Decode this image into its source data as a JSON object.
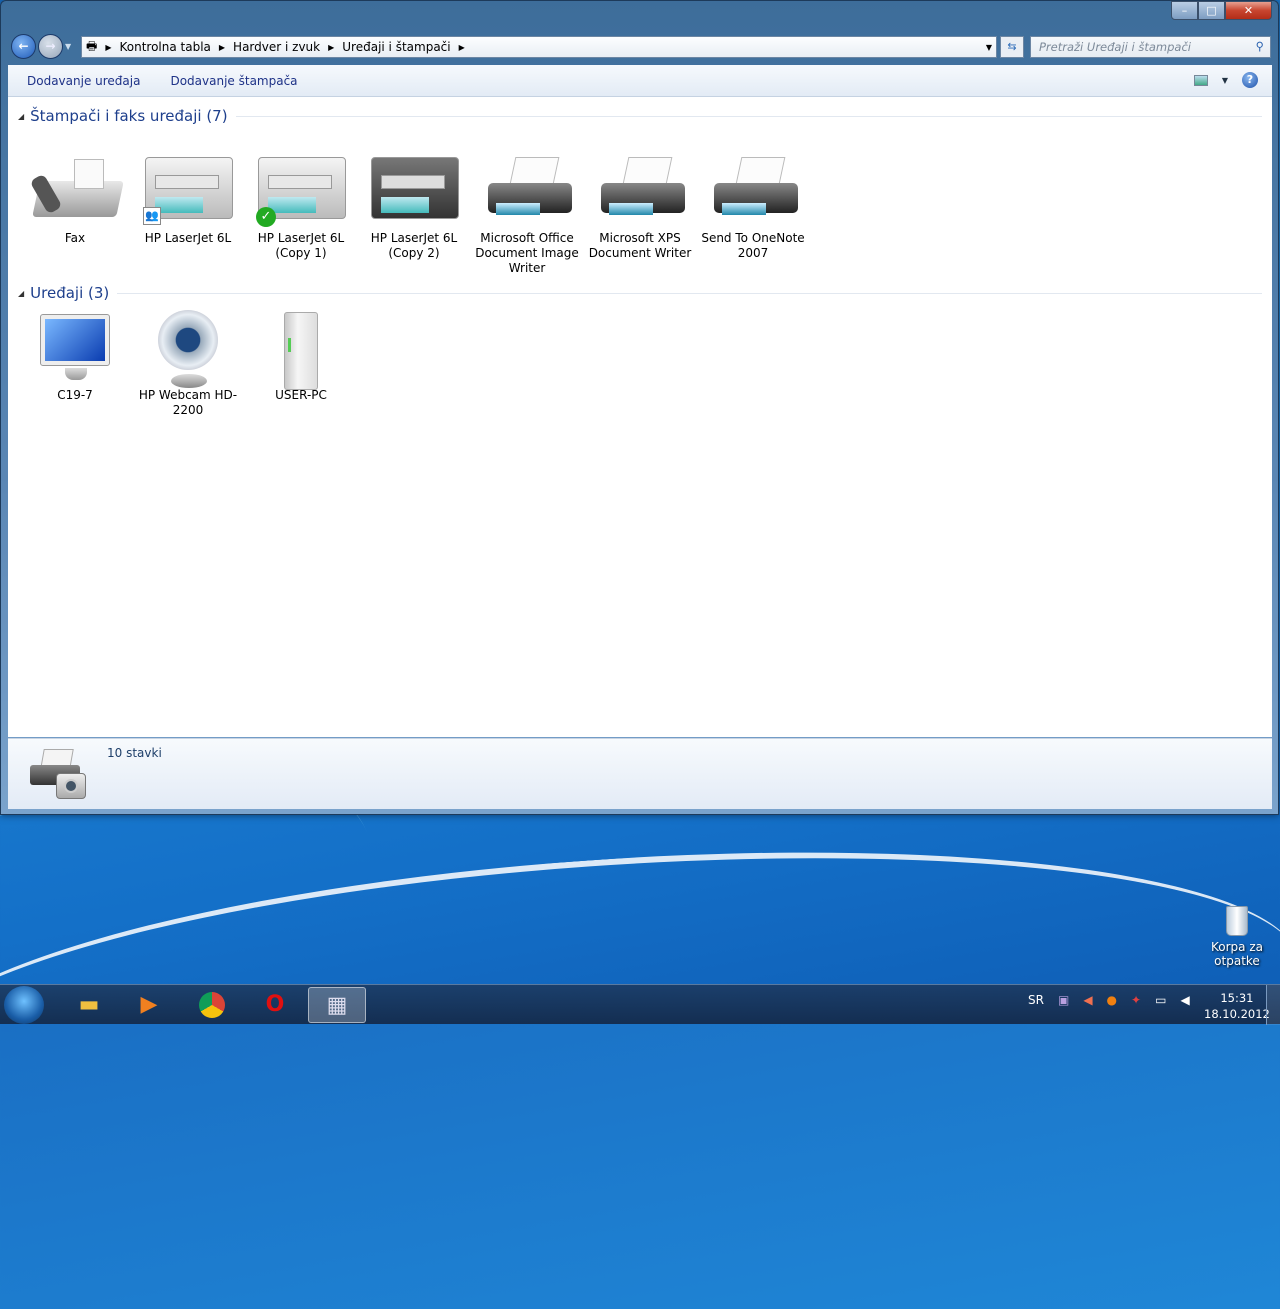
{
  "window": {
    "caption": {
      "minimize": "–",
      "maximize": "□",
      "close": "✕"
    }
  },
  "breadcrumb": [
    "Kontrolna tabla",
    "Hardver i zvuk",
    "Uređaji i štampači"
  ],
  "search": {
    "placeholder": "Pretraži Uređaji i štampači"
  },
  "toolbar": {
    "add_device": "Dodavanje uređaja",
    "add_printer": "Dodavanje štampača",
    "help": "?"
  },
  "groups": [
    {
      "title": "Štampači i faks uređaji (7)",
      "items": [
        {
          "label": "Fax",
          "icon": "fax"
        },
        {
          "label": "HP LaserJet 6L",
          "icon": "laser-shared"
        },
        {
          "label": "HP LaserJet 6L (Copy 1)",
          "icon": "laser-default"
        },
        {
          "label": "HP LaserJet 6L (Copy 2)",
          "icon": "laser-dark"
        },
        {
          "label": "Microsoft Office Document Image Writer",
          "icon": "printer"
        },
        {
          "label": "Microsoft XPS Document Writer",
          "icon": "printer"
        },
        {
          "label": "Send To OneNote 2007",
          "icon": "printer"
        }
      ]
    },
    {
      "title": "Uređaji (3)",
      "items": [
        {
          "label": "C19-7",
          "icon": "monitor"
        },
        {
          "label": "HP Webcam HD-2200",
          "icon": "webcam"
        },
        {
          "label": "USER-PC",
          "icon": "computer"
        }
      ]
    }
  ],
  "details": {
    "count": "10 stavki"
  },
  "desktop": {
    "recycle_bin": "Korpa za otpatke"
  },
  "taskbar": {
    "language": "SR",
    "time": "15:31",
    "date": "18.10.2012"
  }
}
